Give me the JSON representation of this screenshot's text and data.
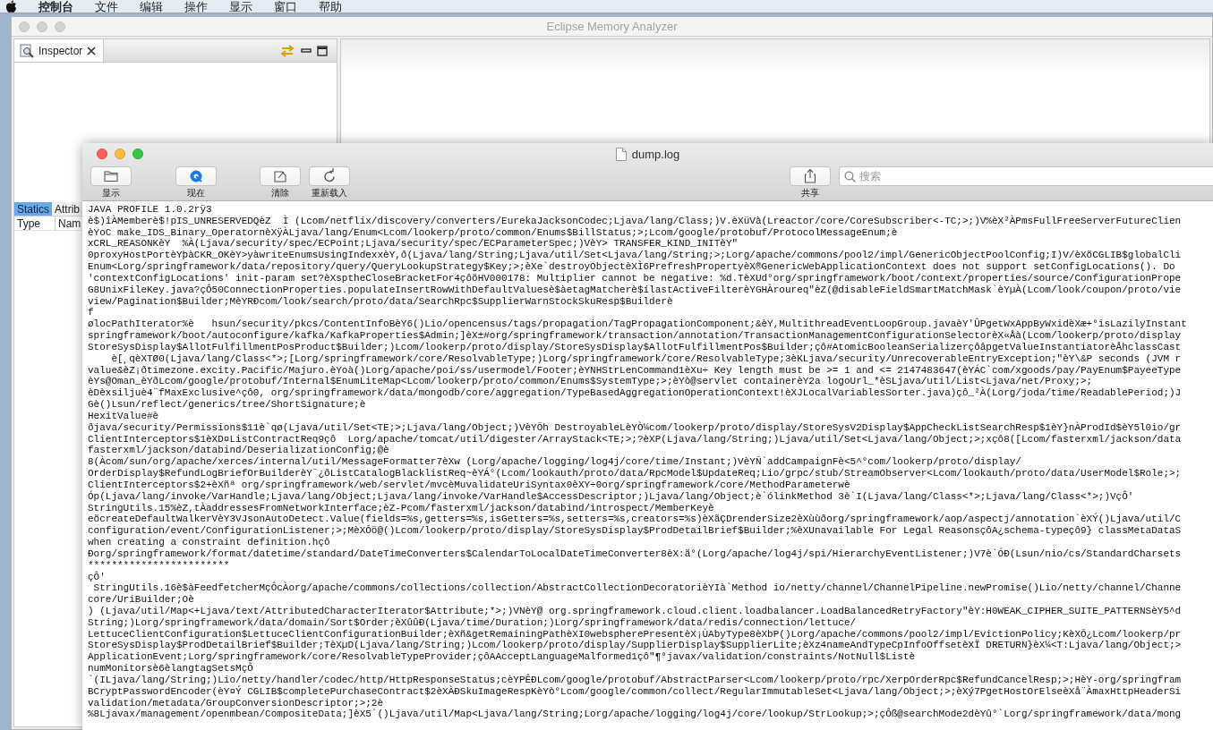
{
  "menu_bar": {
    "items": [
      "控制台",
      "文件",
      "编辑",
      "操作",
      "显示",
      "窗口",
      "帮助"
    ]
  },
  "eclipse_window": {
    "title": "Eclipse Memory Analyzer",
    "view_tab": {
      "label": "Inspector"
    },
    "inspector_tabs": [
      {
        "label": "Statics",
        "selected": true
      },
      {
        "label": "Attrib",
        "selected": false
      }
    ],
    "columns": [
      "Type",
      "Nam"
    ]
  },
  "console_window": {
    "title": "dump.log",
    "tools_left": [
      {
        "label": "显示",
        "kind": "folder"
      },
      {
        "label": "现在",
        "kind": "target"
      },
      {
        "label": "清除",
        "kind": "clear"
      },
      {
        "label": "重新载入",
        "kind": "reload"
      }
    ],
    "tools_right": [
      {
        "label": "共享",
        "kind": "share"
      }
    ],
    "search": {
      "placeholder": "搜索"
    },
    "lines": [
      "JAVA PROFILE 1.0.2rÿ3",
      "è$)îÀMemberè$!pIS_UNRESERVEDQèZ  Ì (Lcom/netflix/discovery/converters/EurekaJacksonCodec;Ljava/lang/Class;)V.èXüVà(Lreactor/core/CoreSubscriber<-TC;>;)V%èX²ÀPmsFullFreeServerFutureClien",
      "èYoC make_IDS_Binary_OperatornèXÿÀLjava/lang/Enum<Lcom/lookerp/proto/common/Enums$BillStatus;>;Lcom/google/protobuf/ProtocolMessageEnum;è",
      "xCRL_REASONKèY  %À(Ljava/security/spec/ECPoint;Ljava/security/spec/ECParameterSpec;)VèY> TRANSFER_KIND_INITèY\"",
      "0proxyHostPortèYþàCKR_OKèY>yàwriteEnumsUsingIndexxèY,ð(Ljava/lang/String;Ljava/util/Set<Ljava/lang/String;>;Lorg/apache/commons/pool2/impl/GenericObjectPoolConfig;I)V/èXõCGLIB$globalCli",
      "Enum<Lorg/springframework/data/repository/query/QueryLookupStrategy$Key;>;èXe`destroyObjectèXÌ6PrefreshPropertyèX®GenericWebApplicationContext does not support setConfigLocations(). Do",
      "'contextConfigLocations' init-param set?èXsptheCloseBracketFor4çôõHV000178: Multiplier cannot be negative: %d.TèXUd°org/springframework/boot/context/properties/source/ConfigurationPrope",
      "G8UnixFileKey.java?çÔ50ConnectionProperties.populateInsertRowWithDefaultValuesè$àetagMatcherè$ílastActiveFilterèYGHÀroureq\"èZ(@disableFieldSmartMatchMask`èYµÀ(Lcom/look/coupon/proto/vie",
      "view/Pagination$Builder;MèYRÐcom/look/search/proto/data/SearchRpc$SupplierWarnStockSkuResp$Builderè",
      "f",
      "ølocPathIterator%è   hsun/security/pkcs/ContentInfoBèY6()Lio/opencensus/tags/propagation/TagPropagationComponent;&èY,MultithreadEventLoopGroup.javaèY'ÛPgetWxAppByWxidèXæ+°isLazilyInstant",
      "springframework/boot/autoconfigure/kafka/KafkaProperties$Admin;]èX±#org/springframework/transaction/annotation/TransactionManagementConfigurationSelectorèX«Åà(Lcom/lookerp/proto/display",
      "StoreSysDisplay$AllotFulfillmentPosProduct$Builder;)Lcom/lookerp/proto/display/StoreSysDisplay$AllotFulfillmentPos$Builder;çô#AtomicBooleanSerializerçôâpgetValueInstantiatorèÅhclassCast",
      "    è[¸qèXTØ0(Ljava/lang/Class<*>;[Lorg/springframework/core/ResolvableType;)Lorg/springframework/core/ResolvableType;3èKLjava/security/UnrecoverableEntryException;\"èY\\&P seconds (JVM r",
      "value&èZ¡ðtimezone.excity.Pacific/Majuro.èYoà()Lorg/apache/poi/ss/usermodel/Footer;èYNHStrLenCommand1èXu÷ Key length must be >= 1 and <= 2147483647(èYÁC`com/xgoods/pay/PayEnum$PayeeType",
      "èYs@Oman_èYðLcom/google/protobuf/Internal$EnumLiteMap<Lcom/lookerp/proto/common/Enums$SystemType;>;èYò@servlet containerèY2a logoUrl_*èSLjava/util/List<Ljava/net/Proxy;>;",
      "èDèxsiljuè4¨fMaxExclusive^çô0, org/springframework/data/mongodb/core/aggregation/TypeBasedAggregationOperationContext!èXJLocalVariablesSorter.java)çô_²À(Lorg/joda/time/ReadablePeriod;)J",
      "Gè()Lsun/reflect/generics/tree/ShortSignature;è",
      "HexitValue#è",
      "ðjava/security/Permissions$11è`qø(Ljava/util/Set<TE;>;Ljava/lang/Object;)VèYÖh DestroyableLèYÒ¼com/lookerp/proto/display/StoreSysV2Display$AppCheckListSearchResp$1èY}nÀProdId$èY5l0io/gr",
      "ClientInterceptors$1èXD¤ListContractReq9çô  Lorg/apache/tomcat/util/digester/ArrayStack<TE;>;?èXP(Ljava/lang/String;)Ljava/util/Set<Ljava/lang/Object;>;xçô8([Lcom/fasterxml/jackson/data",
      "fasterxml/jackson/databind/DeserializationConfig;@è",
      "8(Àcom/sun/org/apache/xerces/internal/util/MessageFormatter7èXw (Lorg/apache/logging/log4j/core/time/Instant;)VèYÑ`addCampaignFè<5^°com/lookerp/proto/display/",
      "OrderDisplay$RefundLogBriefOrBuilderèY¨¿ðListCatalogBlacklistReq~èYÁ°(Lcom/lookauth/proto/data/RpcModel$UpdateReq;Lio/grpc/stub/StreamObserver<Lcom/lookauth/proto/data/UserModel$Role;>;",
      "ClientInterceptors$2+èXñª org/springframework/web/servlet/mvcèMuvalidateUriSyntax0èXY÷0org/springframework/core/MethodParameterwè",
      "Óp(Ljava/lang/invoke/VarHandle;Ljava/lang/Object;Ljava/lang/invoke/VarHandle$AccessDescriptor;)Ljava/lang/Object;è`ólinkMethod 3è`I(Ljava/lang/Class<*>;Ljava/lang/Class<*>;)VçÔ'",
      "StringUtils.15%èZ,tÀaddressesFromNetworkInterface;èZ-Pcom/fasterxml/jackson/databind/introspect/MemberKeyè",
      "eõcreateDefaultWalkerVèY3VJsonAutoDetect.Value(fields=%s,getters=%s,isGetters=%s,setters=%s,creators=%s)èXãÇDrenderSize2èXùùðorg/springframework/aop/aspectj/annotation`èXÝ()Ljava/util/C",
      "configuration/event/ConfigurationListener;>;MèXÕö@()Lcom/lookerp/proto/display/StoreSysDisplay$ProdDetailBrief$Builder;%èXUnavailable For Legal ReasonsçôA¿schema-typeçô9} classMetaDataS",
      "when creating a constraint definition.hçô",
      "Ðorg/springframework/format/datetime/standard/DateTimeConverters$CalendarToLocalDateTimeConverter8èX:ã°(Lorg/apache/log4j/spi/HierarchyEventListener;)V7è`ÓÐ(Lsun/nio/cs/StandardCharsets",
      "************************",
      "çÔ'",
      " StringUtils.16è$àFeedfetcherMçÔcÀorg/apache/commons/collections/collection/AbstractCollectionDecoratorièYIà`Method io/netty/channel/ChannelPipeline.newPromise()Lio/netty/channel/Channe",
      "core/UriBuilder;Oè",
      ") (Ljava/util/Map<+Ljava/text/AttributedCharacterIterator$Attribute;*>;)VNèY@ org.springframework.cloud.client.loadbalancer.LoadBalancedRetryFactory\"èY:H0WEAK_CIPHER_SUITE_PATTERNSèY5^d",
      "String;)Lorg/springframework/data/domain/Sort$Order;èXûûÐ(Ljava/time/Duration;)Lorg/springframework/data/redis/connection/lettuce/",
      "LettuceClientConfiguration$LettuceClientConfigurationBuilder;èXñ&getRemainingPathèXI0webspherePresentèX¡ÙAbyType8èXbP()Lorg/apache/commons/pool2/impl/EvictionPolicy;KèXÕ¿Lcom/lookerp/pr",
      "StoreSysDisplay$ProdDetailBrief$Builder;TèXµD(Ljava/lang/String;)Lcom/lookerp/proto/display/SupplierDisplay$SupplierLite;èXz4nameAndTypeCpInfoOffsetèXÏ DRETURN}èX¼<T:Ljava/lang/Object;>",
      "ApplicationEvent;Lorg/springframework/core/ResolvableTypeProvider;çôAAcceptLanguageMalformed1çô\"¶°javax/validation/constraints/NotNull$Listè",
      "numMonitorsè6èlangtagSetsMçÔ",
      "`(ILjava/lang/String;)Lio/netty/handler/codec/http/HttpResponseStatus;cèYPÊÐLcom/google/protobuf/AbstractParser<Lcom/lookerp/proto/rpc/XerpOrderRpc$RefundCancelResp;>;HèY-org/springfram",
      "BCryptPasswordEncoder(èY¤Ý CGLIB$completePurchaseContract$2èXÀÐSkuImageRespKèYò°Lcom/google/common/collect/RegularImmutableSet<Ljava/lang/Object;>;èXý7PgetHostOrElseèXå¨ÀmaxHttpHeaderSi",
      "validation/metadata/GroupConversionDescriptor;>;2è",
      "%8Ljavax/management/openmbean/CompositeData;]èX5`()Ljava/util/Map<Ljava/lang/String;Lorg/apache/logging/log4j/core/lookup/StrLookup;>;çÔß@searchMode2dèYû°`Lorg/springframework/data/mong"
    ]
  }
}
